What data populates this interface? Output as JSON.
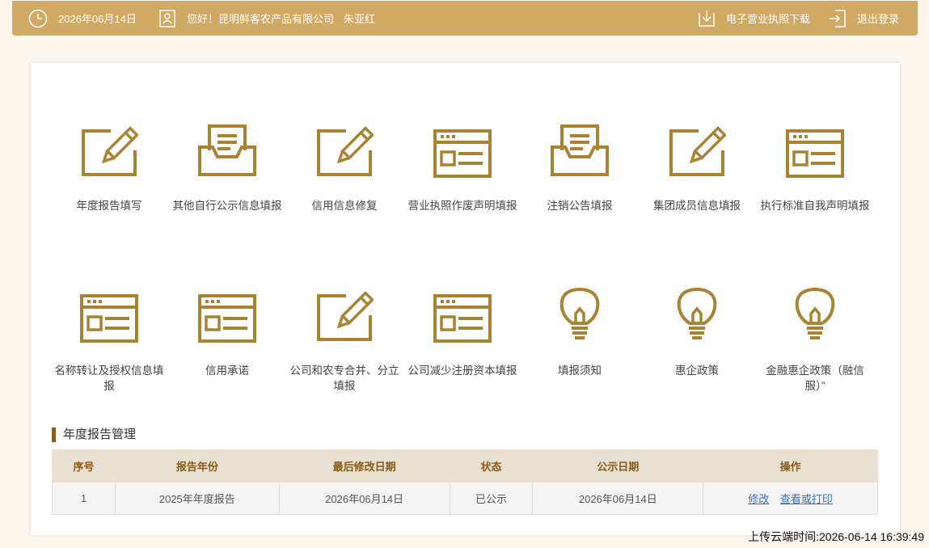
{
  "topbar": {
    "date": "2026年06月14日",
    "greeting": "您好！昆明鲜客农产品有限公司",
    "user": "朱亚红",
    "license_download": "电子营业执照下载",
    "logout": "退出登录"
  },
  "tiles": [
    {
      "label": "年度报告填写",
      "icon": "pencil-edit-icon"
    },
    {
      "label": "其他自行公示信息填报",
      "icon": "document-tray-icon"
    },
    {
      "label": "信用信息修复",
      "icon": "pencil-edit-icon"
    },
    {
      "label": "营业执照作废声明填报",
      "icon": "web-form-icon"
    },
    {
      "label": "注销公告填报",
      "icon": "document-tray-icon"
    },
    {
      "label": "集团成员信息填报",
      "icon": "pencil-edit-icon"
    },
    {
      "label": "执行标准自我声明填报",
      "icon": "web-form-icon"
    },
    {
      "label": "名称转让及授权信息填报",
      "icon": "web-form-icon"
    },
    {
      "label": "信用承诺",
      "icon": "web-form-icon"
    },
    {
      "label": "公司和农专合并、分立填报",
      "icon": "pencil-edit-icon"
    },
    {
      "label": "公司减少注册资本填报",
      "icon": "web-form-icon"
    },
    {
      "label": "填报须知",
      "icon": "lightbulb-icon"
    },
    {
      "label": "惠企政策",
      "icon": "lightbulb-icon"
    },
    {
      "label": "金融惠企政策（融信服）”",
      "icon": "lightbulb-icon"
    }
  ],
  "section": {
    "title": "年度报告管理"
  },
  "table": {
    "headers": [
      "序号",
      "报告年份",
      "最后修改日期",
      "状态",
      "公示日期",
      "操作"
    ],
    "rows": [
      {
        "index": "1",
        "report_year": "2025年年度报告",
        "modified": "2026年06月14日",
        "status": "已公示",
        "publish_date": "2026年06月14日",
        "action_edit": "修改",
        "action_view": "查看或打印"
      }
    ]
  },
  "footer": {
    "upload_time": "上传云端时间:2026-06-14 16:39:49"
  },
  "colors": {
    "gold": "#a98332",
    "topbar": "#d0a965",
    "accent_dark": "#8b5a14"
  }
}
